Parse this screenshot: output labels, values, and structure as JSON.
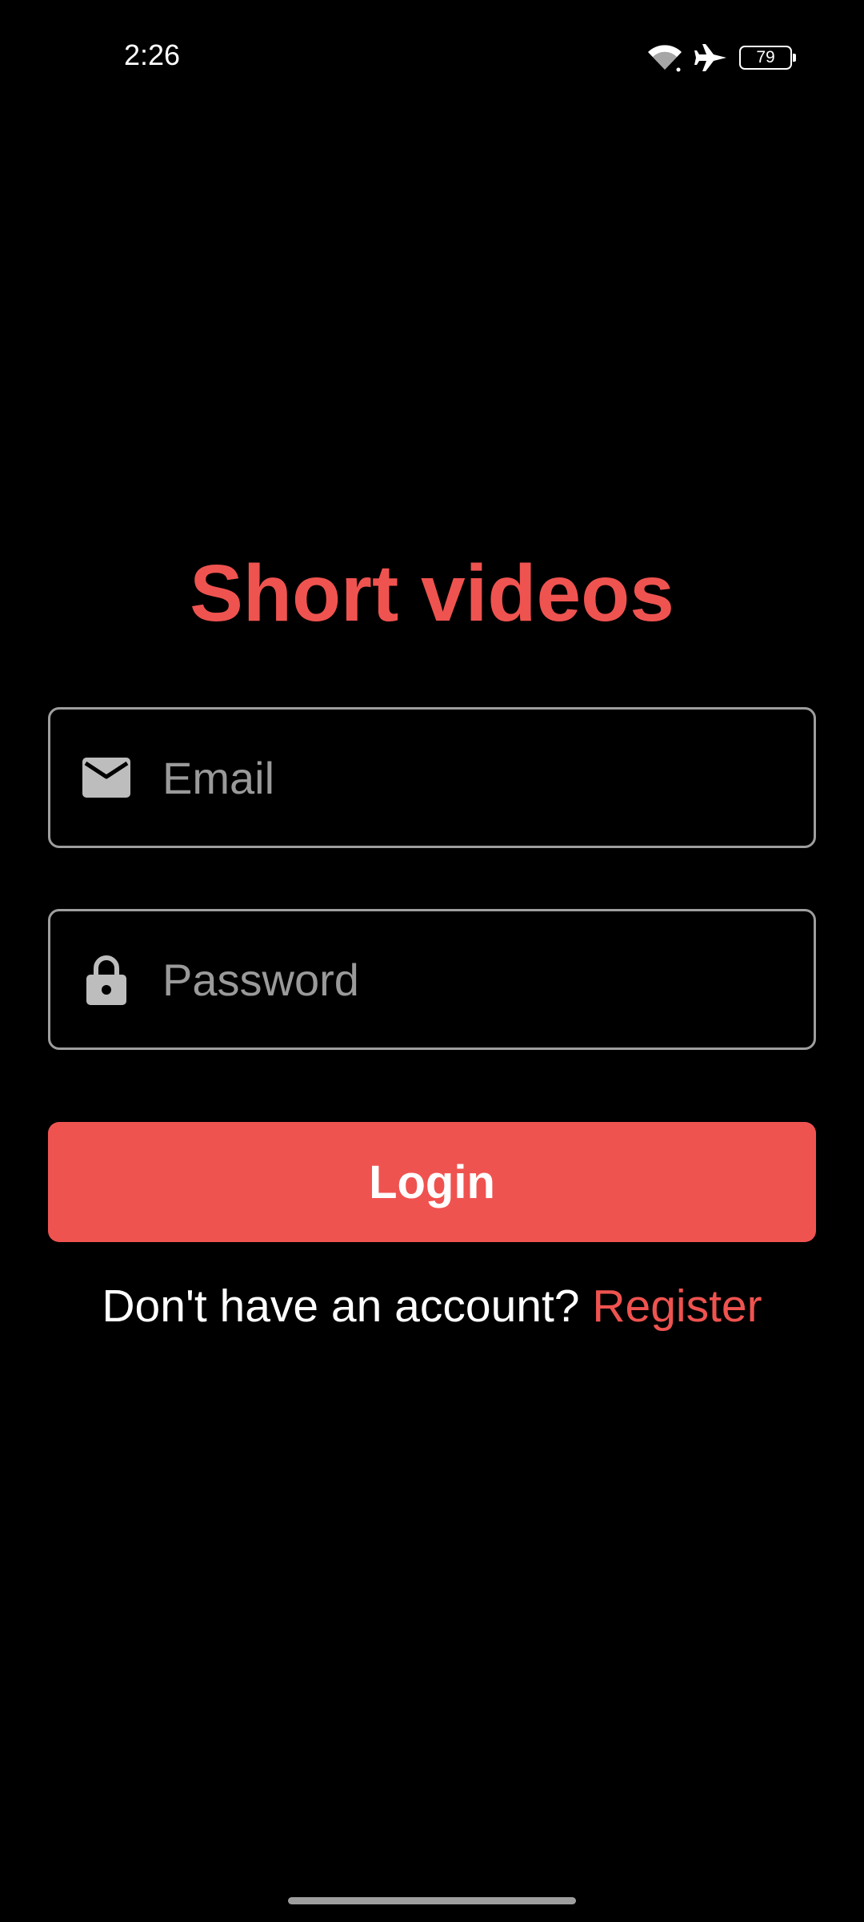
{
  "status_bar": {
    "time": "2:26",
    "battery_level": "79",
    "icons": [
      "wifi-icon",
      "airplane-mode-icon",
      "battery-icon"
    ]
  },
  "app": {
    "title": "Short videos"
  },
  "form": {
    "email": {
      "value": "",
      "placeholder": "Email",
      "icon": "mail-icon"
    },
    "password": {
      "value": "",
      "placeholder": "Password",
      "icon": "lock-icon"
    },
    "login_label": "Login"
  },
  "register": {
    "prompt": "Don't have an account? ",
    "link_label": "Register"
  },
  "colors": {
    "accent": "#ef5350",
    "background": "#000000",
    "field_border": "#9e9e9e",
    "placeholder": "#9a9a9a"
  }
}
